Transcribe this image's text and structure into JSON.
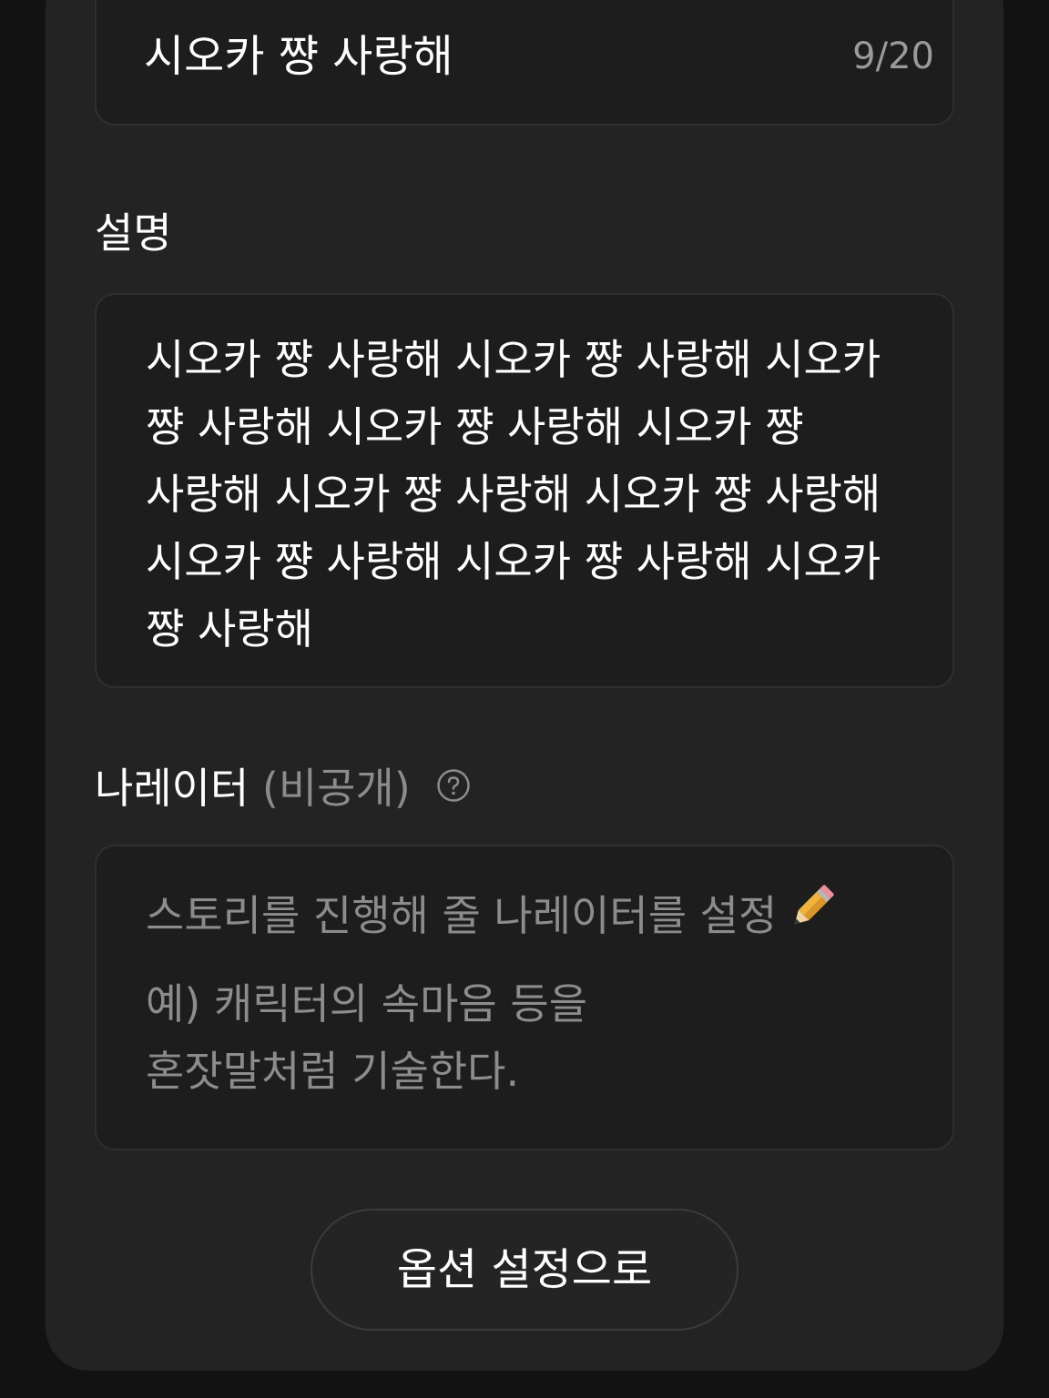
{
  "title_field": {
    "value": "시오카 쨩 사랑해",
    "counter": "9/20"
  },
  "description": {
    "label": "설명",
    "value": "시오카 쨩 사랑해 시오카 쨩 사랑해 시오카 쨩 사랑해 시오카 쨩 사랑해 시오카 쨩 사랑해 시오카 쨩 사랑해 시오카 쨩 사랑해 시오카 쨩 사랑해 시오카 쨩 사랑해 시오카 쨩 사랑해"
  },
  "narrator": {
    "label": "나레이터",
    "label_suffix": "(비공개)",
    "help_icon": "question-circle-icon",
    "placeholder_line1": "스토리를 진행해 줄 나레이터를 설정",
    "placeholder_icon": "pencil-icon",
    "placeholder_example": "예) 캐릭터의 속마음 등을 혼잣말처럼 기술한다."
  },
  "footer": {
    "button_label": "옵션 설정으로"
  }
}
